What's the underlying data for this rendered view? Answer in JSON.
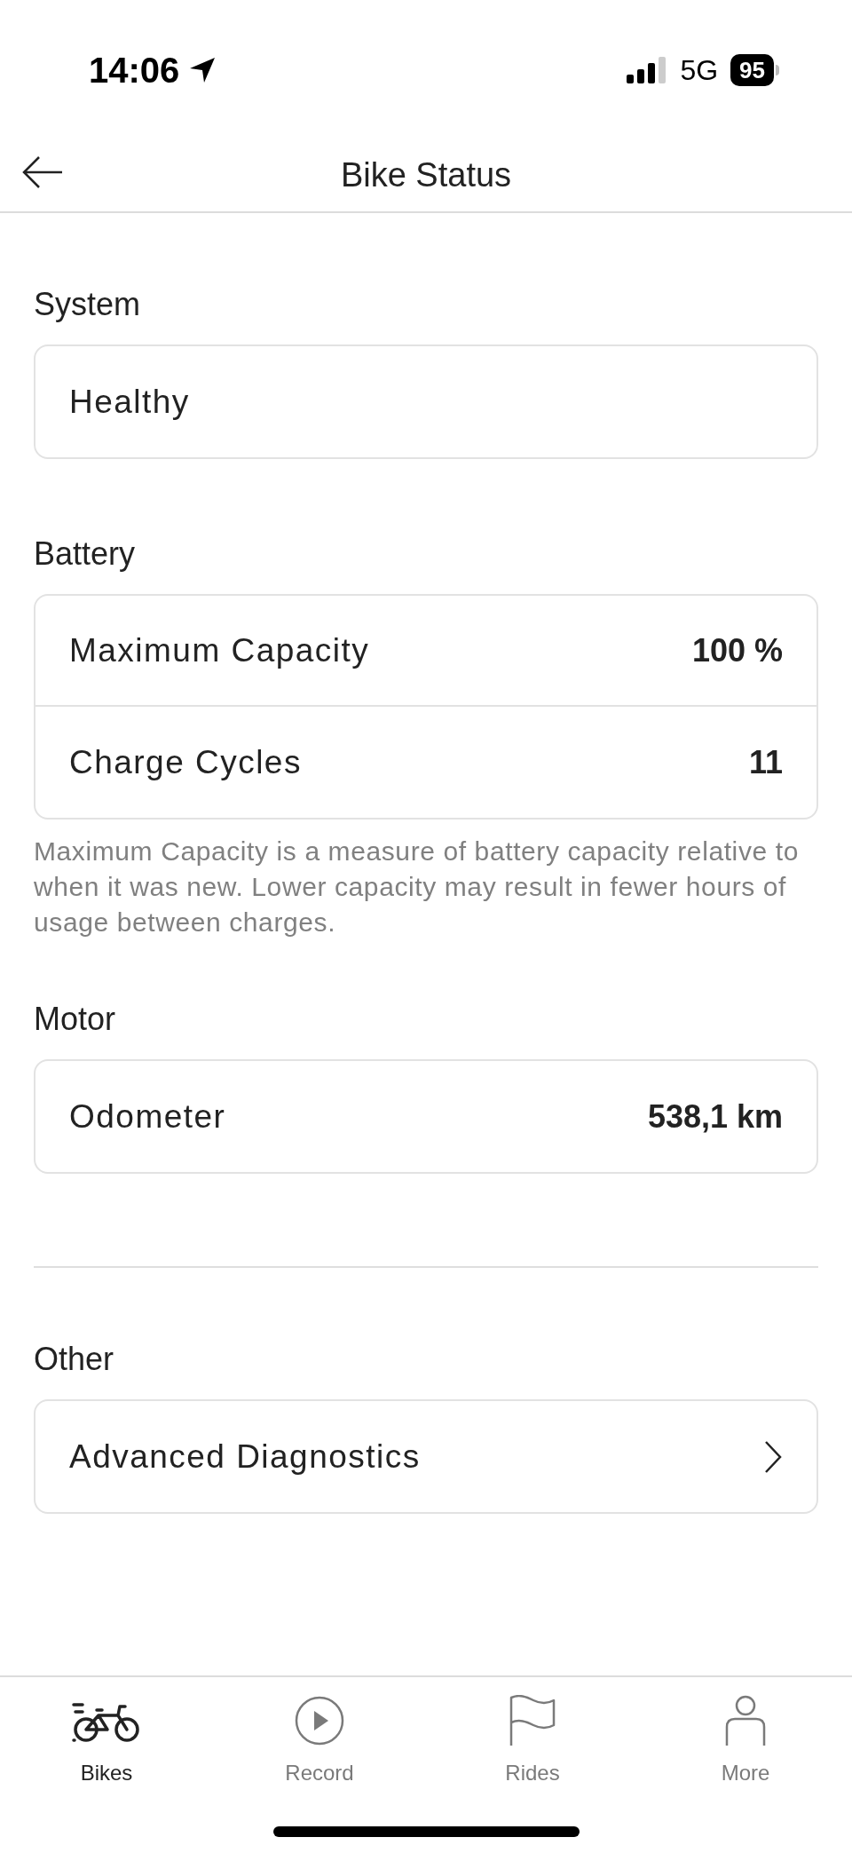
{
  "status_bar": {
    "time": "14:06",
    "network": "5G",
    "battery": "95"
  },
  "header": {
    "title": "Bike Status"
  },
  "sections": [
    {
      "title": "System",
      "rows": [
        {
          "kind": "text",
          "label": "Healthy"
        }
      ]
    },
    {
      "title": "Battery",
      "rows": [
        {
          "kind": "value",
          "label": "Maximum Capacity",
          "value": "100 %"
        },
        {
          "kind": "value",
          "label": "Charge Cycles",
          "value": "11"
        }
      ],
      "note": "Maximum Capacity is a measure of battery capacity relative to when it was new. Lower capacity may result in fewer hours of usage between charges."
    },
    {
      "title": "Motor",
      "rows": [
        {
          "kind": "value",
          "label": "Odometer",
          "value": "538,1 km"
        }
      ]
    },
    {
      "title": "Other",
      "divider_before": true,
      "rows": [
        {
          "kind": "link",
          "label": "Advanced Diagnostics"
        }
      ]
    }
  ],
  "tabs": [
    {
      "label": "Bikes",
      "kind": "bike",
      "selected": true
    },
    {
      "label": "Record",
      "kind": "play",
      "selected": false
    },
    {
      "label": "Rides",
      "kind": "flag",
      "selected": false
    },
    {
      "label": "More",
      "kind": "person",
      "selected": false
    }
  ]
}
